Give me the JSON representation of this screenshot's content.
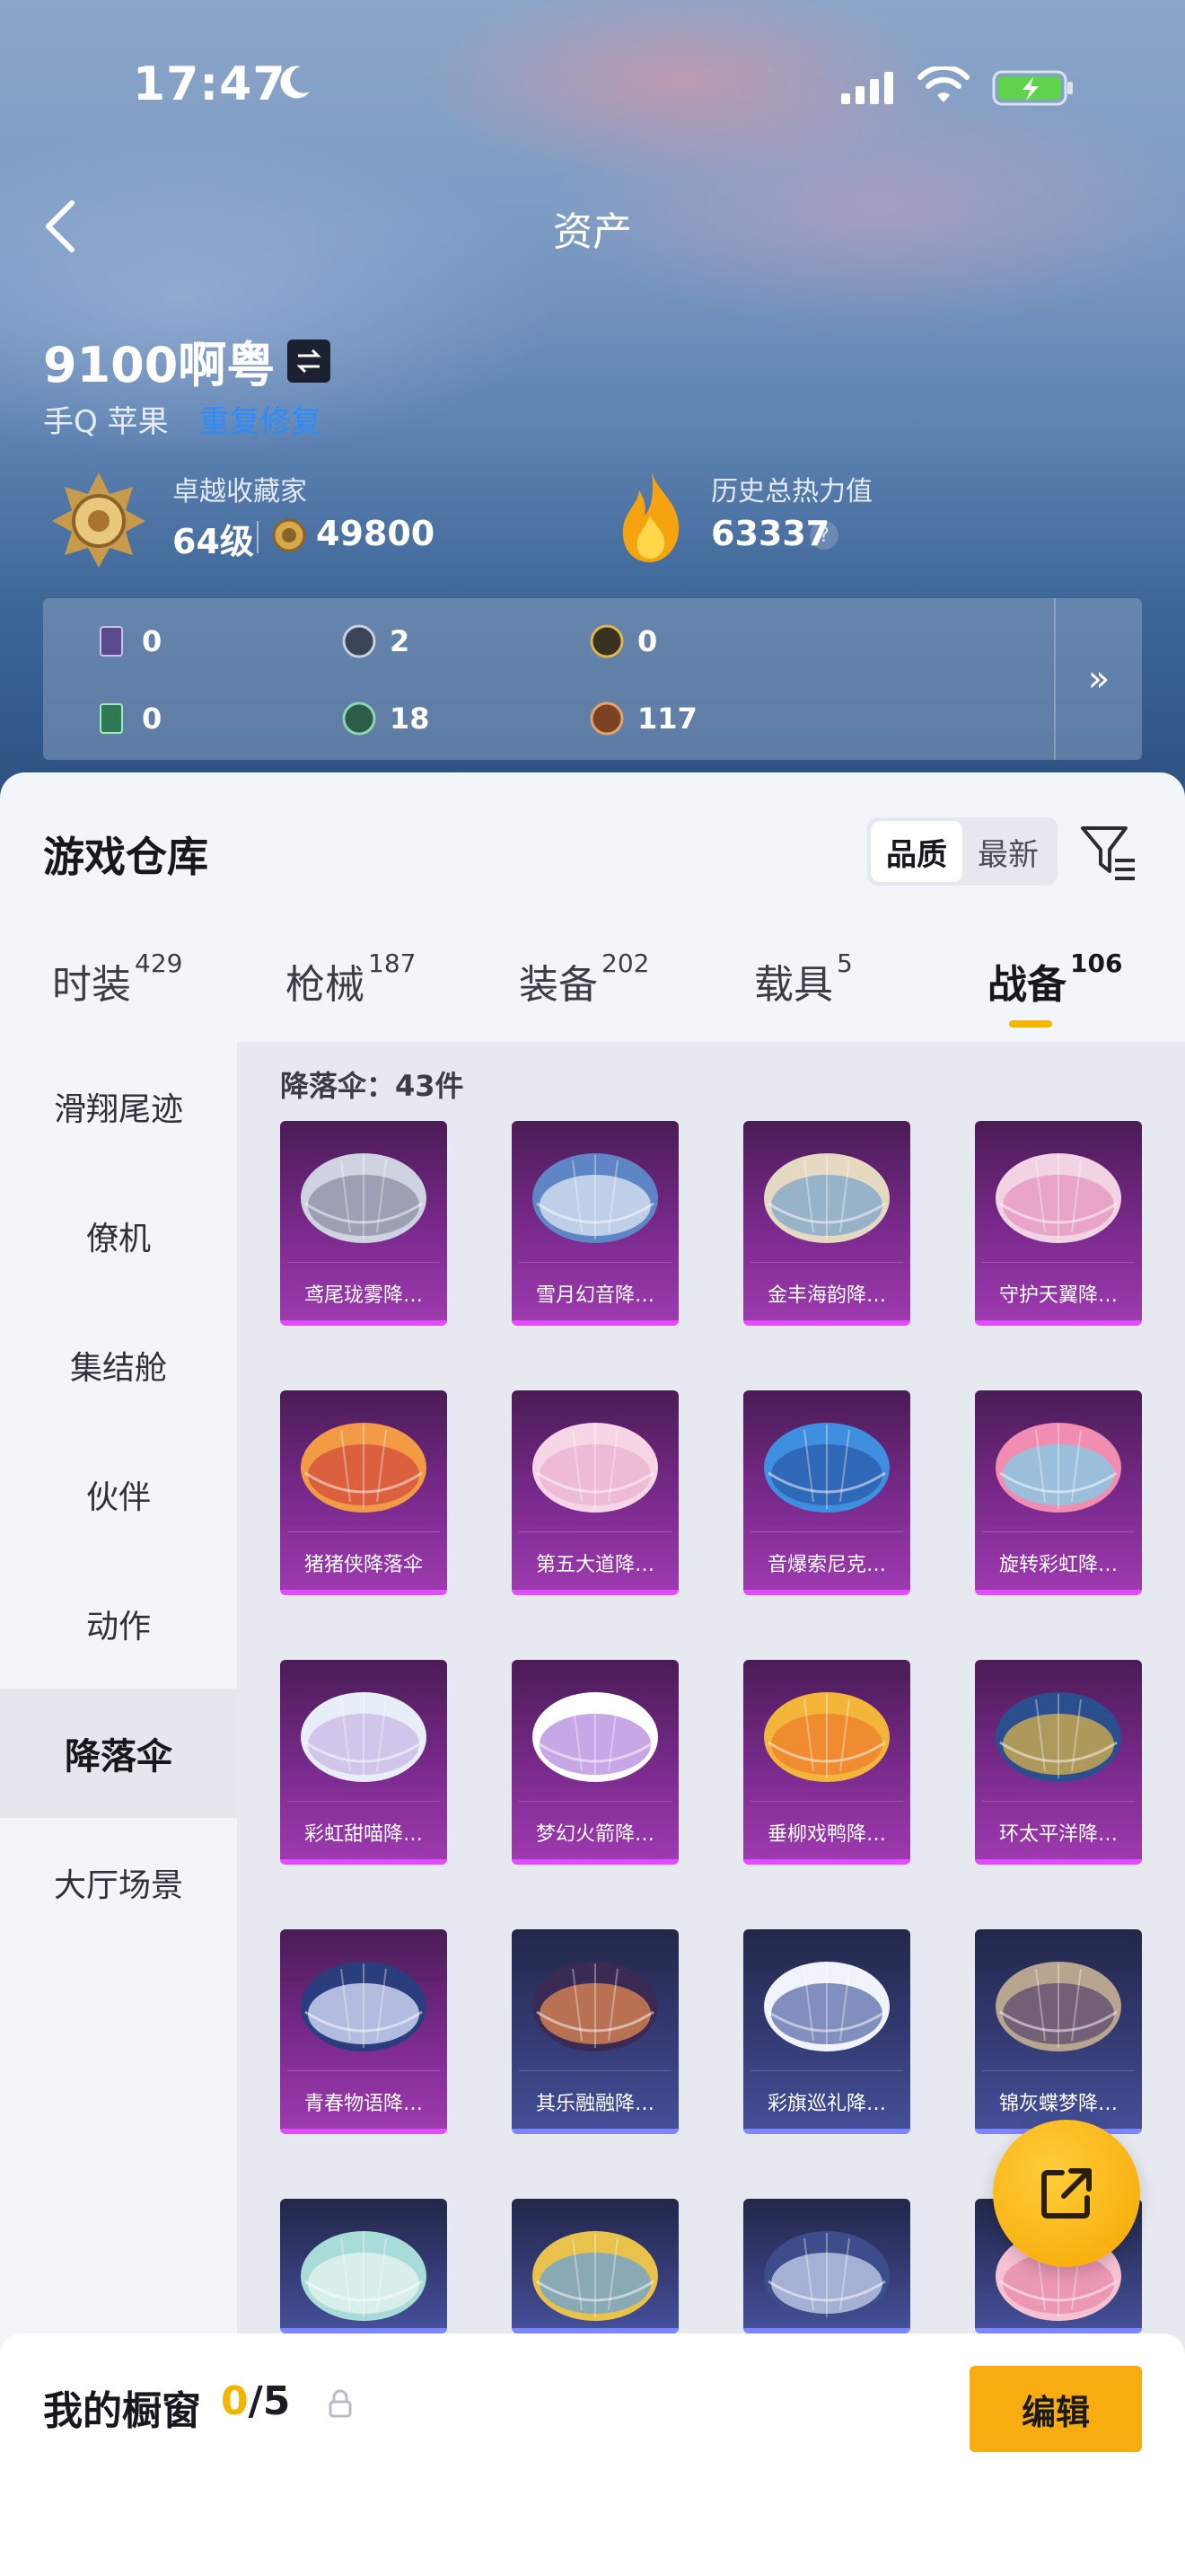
{
  "status_bar": {
    "time": "17:47"
  },
  "header": {
    "title": "资产"
  },
  "profile": {
    "username": "9100啊粤",
    "platform": "手Q 苹果",
    "fix_link": "重复修复",
    "collector_title": "卓越收藏家",
    "collector_level": "64级",
    "collector_points": "49800",
    "heat_title": "历史总热力值",
    "heat_value": "63337",
    "help_glyph": "?"
  },
  "resources": {
    "items": [
      {
        "icon": "purple-card-icon",
        "value": "0"
      },
      {
        "icon": "silver-coin-icon",
        "value": "2"
      },
      {
        "icon": "gold-coin-icon",
        "value": "0"
      },
      {
        "icon": "green-card-icon",
        "value": "0"
      },
      {
        "icon": "green-orb-icon",
        "value": "18"
      },
      {
        "icon": "bronze-coin-icon",
        "value": "117"
      }
    ],
    "more_glyph": "»"
  },
  "warehouse": {
    "title": "游戏仓库",
    "sort_options": [
      "品质",
      "最新"
    ],
    "tabs": [
      {
        "label": "时装",
        "count": "429"
      },
      {
        "label": "枪械",
        "count": "187"
      },
      {
        "label": "装备",
        "count": "202"
      },
      {
        "label": "载具",
        "count": "5"
      },
      {
        "label": "战备",
        "count": "106"
      }
    ],
    "side_categories": [
      "滑翔尾迹",
      "僚机",
      "集结舱",
      "伙伴",
      "动作",
      "降落伞",
      "大厅场景"
    ],
    "section_title": "降落伞：43件",
    "items": [
      {
        "name": "鸢尾珑雾降…",
        "rarity": "purple"
      },
      {
        "name": "雪月幻音降…",
        "rarity": "purple"
      },
      {
        "name": "金丰海韵降…",
        "rarity": "purple"
      },
      {
        "name": "守护天翼降…",
        "rarity": "purple"
      },
      {
        "name": "猪猪侠降落伞",
        "rarity": "purple"
      },
      {
        "name": "第五大道降…",
        "rarity": "purple"
      },
      {
        "name": "音爆索尼克…",
        "rarity": "purple"
      },
      {
        "name": "旋转彩虹降…",
        "rarity": "purple"
      },
      {
        "name": "彩虹甜喵降…",
        "rarity": "purple"
      },
      {
        "name": "梦幻火箭降…",
        "rarity": "purple"
      },
      {
        "name": "垂柳戏鸭降…",
        "rarity": "purple"
      },
      {
        "name": "环太平洋降…",
        "rarity": "purple"
      },
      {
        "name": "青春物语降…",
        "rarity": "purple"
      },
      {
        "name": "其乐融融降…",
        "rarity": "blue"
      },
      {
        "name": "彩旗巡礼降…",
        "rarity": "blue"
      },
      {
        "name": "锦灰蝶梦降…",
        "rarity": "blue"
      },
      {
        "name": "",
        "rarity": "blue"
      },
      {
        "name": "",
        "rarity": "blue"
      },
      {
        "name": "",
        "rarity": "blue"
      },
      {
        "name": "",
        "rarity": "blue"
      }
    ]
  },
  "showcase": {
    "label": "我的橱窗",
    "current": "0",
    "total": "/5",
    "edit_label": "编辑"
  },
  "colors": {
    "accent": "#f5b400",
    "link": "#2a8cff",
    "purple_rarity": "#e04cff",
    "blue_rarity": "#7b86ff"
  }
}
